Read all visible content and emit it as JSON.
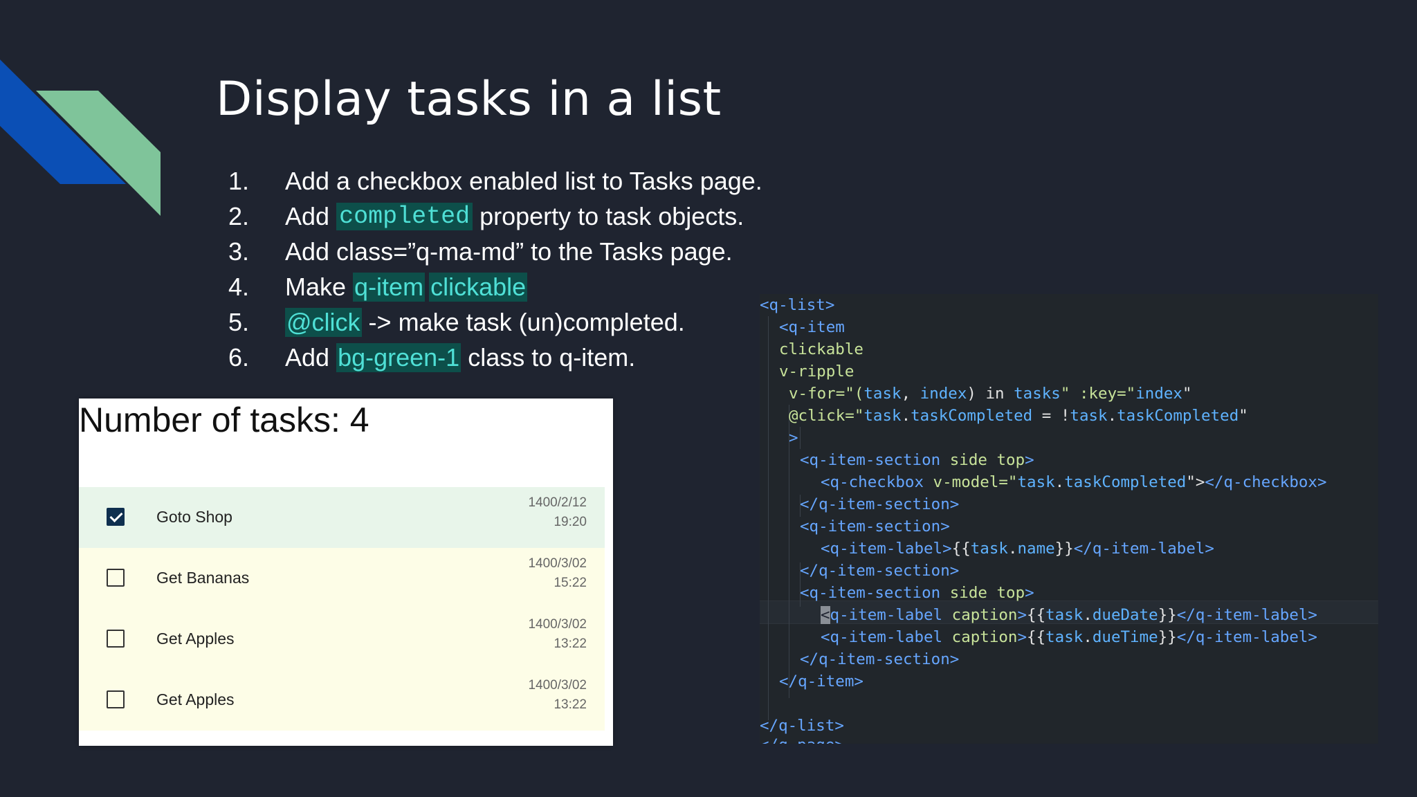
{
  "slide": {
    "title": "Display tasks in a list",
    "steps": [
      {
        "num": "1.",
        "a": "Add a checkbox enabled list to Tasks page."
      },
      {
        "num": "2.",
        "a": "Add ",
        "code": "completed",
        "b": " property to task objects."
      },
      {
        "num": "3.",
        "a": "Add class=”q-ma-md” to the Tasks page."
      },
      {
        "num": "4.",
        "a": "Make ",
        "hl1": "q-item",
        "hl2": "clickable"
      },
      {
        "num": "5.",
        "hl1": "@click",
        "b": " -> make task (un)completed."
      },
      {
        "num": "6.",
        "a": "Add ",
        "hl1": "bg-green-1",
        "b": " class to q-item."
      }
    ]
  },
  "task_panel": {
    "header": "Number of tasks: 4",
    "tasks": [
      {
        "name": "Goto Shop",
        "date": "1400/2/12",
        "time": "19:20",
        "completed": true
      },
      {
        "name": "Get Bananas",
        "date": "1400/3/02",
        "time": "15:22",
        "completed": false
      },
      {
        "name": "Get Apples",
        "date": "1400/3/02",
        "time": "13:22",
        "completed": false
      },
      {
        "name": "Get Apples",
        "date": "1400/3/02",
        "time": "13:22",
        "completed": false
      }
    ]
  },
  "code": {
    "l1": "<q-list>",
    "l2": "<q-item",
    "l3": "clickable",
    "l4": "v-ripple",
    "l5a": "v-for=\"(",
    "l5b": "task",
    "l5c": ", ",
    "l5d": "index",
    "l5e": ") in ",
    "l5f": "tasks",
    "l5g": "\" :key=\"",
    "l5h": "index",
    "l5i": "\"",
    "l6a": "@click=\"",
    "l6b": "task",
    "l6c": ".",
    "l6d": "taskCompleted",
    "l6e": " = !",
    "l6f": "task",
    "l6g": ".",
    "l6h": "taskCompleted",
    "l6i": "\"",
    "l7": ">",
    "l8a": "<q-item-section",
    "l8b": " side top",
    "l8c": ">",
    "l9a": "<q-checkbox",
    "l9b": " v-model=\"",
    "l9c": "task",
    "l9d": ".",
    "l9e": "taskCompleted",
    "l9f": "\">",
    "l9g": "</q-checkbox>",
    "l10": "</q-item-section>",
    "l11": "<q-item-section>",
    "l12a": "<q-item-label>",
    "l12b": "{{",
    "l12c": "task",
    "l12d": ".",
    "l12e": "name",
    "l12f": "}}",
    "l12g": "</q-item-label>",
    "l13": "</q-item-section>",
    "l14a": "<q-item-section",
    "l14b": " side top",
    "l14c": ">",
    "l15a": "<",
    "l15b": "q-item-label",
    "l15c": " caption",
    "l15d": ">",
    "l15e": "{{",
    "l15f": "task",
    "l15g": ".",
    "l15h": "dueDate",
    "l15i": "}}",
    "l15j": "</q-item-label>",
    "l16a": "<q-item-label",
    "l16b": " caption",
    "l16c": ">",
    "l16d": "{{",
    "l16e": "task",
    "l16f": ".",
    "l16g": "dueTime",
    "l16h": "}}",
    "l16i": "</q-item-label>",
    "l17": "</q-item-section>",
    "l18": "</q-item>",
    "l19": "</q-list>",
    "l20": "</q-page>"
  },
  "colors": {
    "background": "#1f2430",
    "deco_blue": "#0b4fb5",
    "deco_green": "#7fc49a",
    "highlight_bg": "#0d4f4a",
    "highlight_text": "#4fe0d6"
  }
}
